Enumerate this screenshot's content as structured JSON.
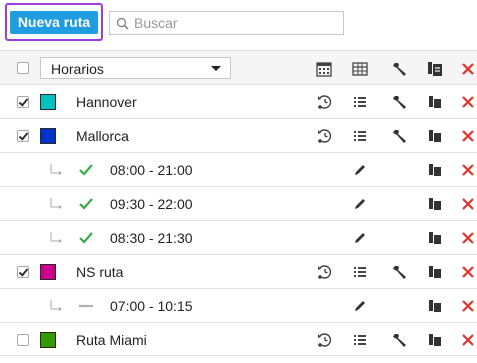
{
  "toolbar": {
    "new_route_label": "Nueva ruta",
    "search_placeholder": "Buscar"
  },
  "header": {
    "filter_select_value": "Horarios"
  },
  "colors": {
    "accent_button": "#1f9de0",
    "highlight_frame": "#9b3fd6",
    "delete_icon": "#e0332b",
    "checkmark_green": "#3aa94a"
  },
  "rows": [
    {
      "kind": "route",
      "name": "Hannover",
      "checked": true,
      "color": "#00c0c0"
    },
    {
      "kind": "route",
      "name": "Mallorca",
      "checked": true,
      "color": "#0033cc"
    },
    {
      "kind": "schedule",
      "time": "08:00 - 21:00",
      "status": "check-icon"
    },
    {
      "kind": "schedule",
      "time": "09:30 - 22:00",
      "status": "check-icon"
    },
    {
      "kind": "schedule",
      "time": "08:30 - 21:30",
      "status": "check-icon"
    },
    {
      "kind": "route",
      "name": "NS ruta",
      "checked": true,
      "color": "#cc0088"
    },
    {
      "kind": "schedule",
      "time": "07:00 - 10:15",
      "status": "dash-icon"
    },
    {
      "kind": "route",
      "name": "Ruta Miami",
      "checked": false,
      "color": "#339900"
    }
  ]
}
